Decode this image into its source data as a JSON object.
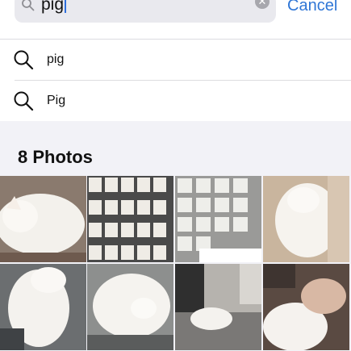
{
  "search": {
    "query": "pig",
    "cancel_label": "Cancel"
  },
  "suggestions": [
    {
      "label": "pig"
    },
    {
      "label": "Pig"
    }
  ],
  "photos": {
    "heading": "8 Photos"
  },
  "icons": {
    "search": "magnifying-glass-icon",
    "clear": "clear-circle-icon"
  },
  "colors": {
    "accent": "#2f76d6",
    "caret": "#2f6fdc",
    "background": "#f2f2f7"
  }
}
